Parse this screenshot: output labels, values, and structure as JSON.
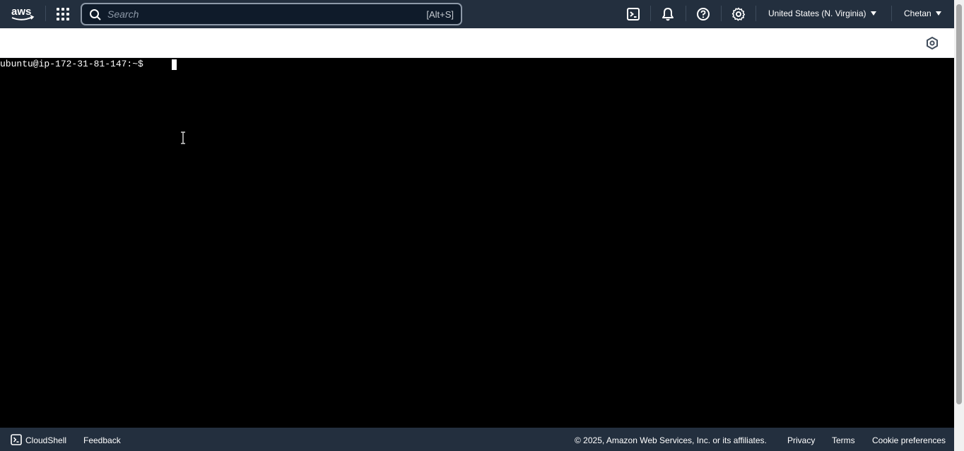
{
  "topnav": {
    "logo_text": "aws",
    "search_placeholder": "Search",
    "search_shortcut": "[Alt+S]",
    "icons": [
      "cloudshell-icon",
      "bell-icon",
      "help-icon",
      "gear-icon"
    ],
    "region_label": "United States (N. Virginia)",
    "user_label": "Chetan"
  },
  "terminal": {
    "prompt": "ubuntu@ip-172-31-81-147:~$ "
  },
  "footer": {
    "cloudshell_label": "CloudShell",
    "feedback_label": "Feedback",
    "copyright": "© 2025, Amazon Web Services, Inc. or its affiliates.",
    "privacy_label": "Privacy",
    "terms_label": "Terms",
    "cookie_label": "Cookie preferences"
  },
  "colors": {
    "nav_bg": "#232f3e",
    "terminal_bg": "#000000",
    "aws_orange": "#ff9900"
  }
}
